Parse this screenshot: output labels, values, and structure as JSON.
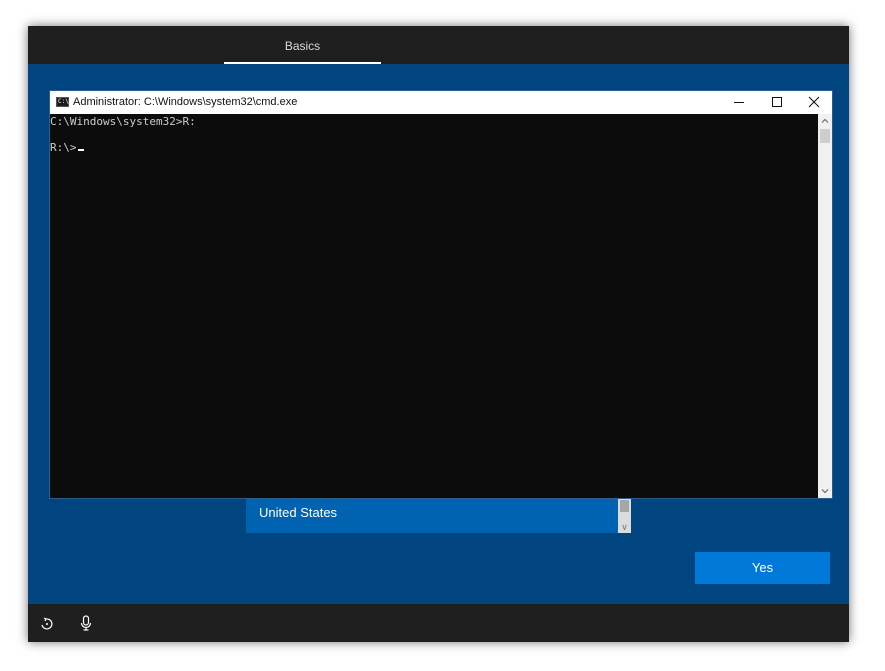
{
  "oobe": {
    "header": {
      "tab_label": "Basics"
    },
    "region_list": {
      "selected_item": "United States"
    },
    "yes_button_label": "Yes",
    "footer": {
      "icons": [
        "ease-of-access-icon",
        "microphone-icon"
      ]
    }
  },
  "cmd": {
    "title": "Administrator: C:\\Windows\\system32\\cmd.exe",
    "icon_text": "C:\\",
    "lines": [
      "C:\\Windows\\system32>R:",
      "",
      "R:\\>"
    ],
    "controls": [
      "minimize",
      "maximize",
      "close"
    ]
  },
  "colors": {
    "oobe_background": "#00457f",
    "accent": "#0078d7",
    "list_selected": "#0063b1",
    "bar_background": "#1f1f1f",
    "console_background": "#0c0c0c"
  }
}
